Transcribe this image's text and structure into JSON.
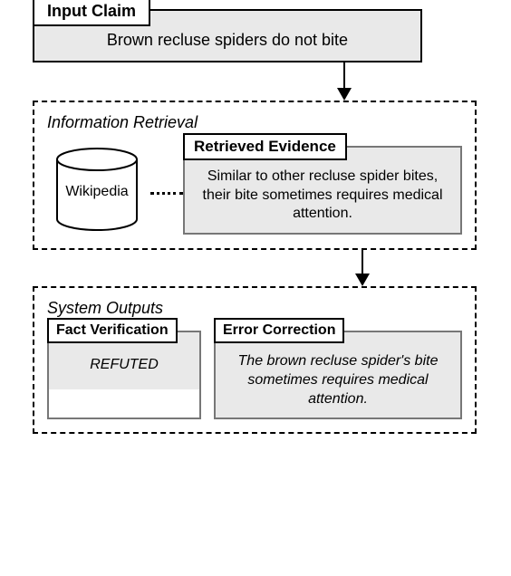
{
  "input": {
    "title": "Input Claim",
    "text": "Brown recluse spiders do not bite"
  },
  "ir": {
    "title": "Information Retrieval",
    "db_label": "Wikipedia",
    "evidence": {
      "title": "Retrieved Evidence",
      "text": "Similar to other recluse spider bites, their bite sometimes requires medical attention."
    }
  },
  "out": {
    "title": "System Outputs",
    "fv": {
      "title": "Fact Verification",
      "value": "REFUTED"
    },
    "ec": {
      "title": "Error Correction",
      "value": "The brown recluse spider's bite sometimes requires medical attention."
    }
  }
}
